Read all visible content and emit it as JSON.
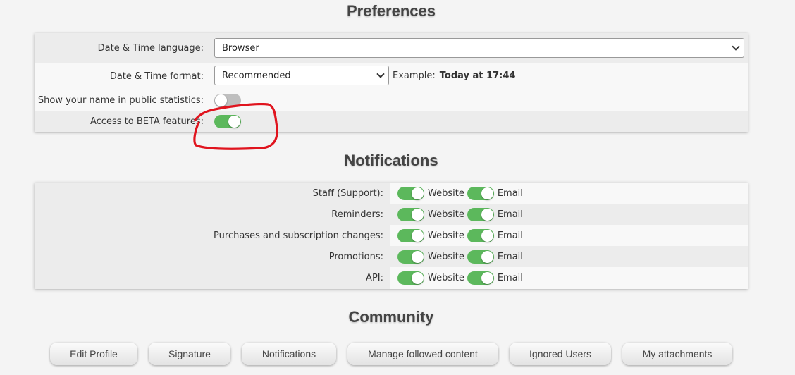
{
  "sections": {
    "preferences": "Preferences",
    "notifications": "Notifications",
    "community": "Community"
  },
  "preferences": {
    "date_time_language": {
      "label": "Date & Time language:",
      "value": "Browser"
    },
    "date_time_format": {
      "label": "Date & Time format:",
      "value": "Recommended",
      "example_prefix": "Example:",
      "example_value": "Today at 17:44"
    },
    "show_name": {
      "label": "Show your name in public statistics:",
      "enabled": false
    },
    "beta": {
      "label": "Access to BETA features:",
      "enabled": true
    }
  },
  "notifications": {
    "website_label": "Website",
    "email_label": "Email",
    "rows": [
      {
        "label": "Staff (Support):",
        "website": true,
        "email": true
      },
      {
        "label": "Reminders:",
        "website": true,
        "email": true
      },
      {
        "label": "Purchases and subscription changes:",
        "website": true,
        "email": true
      },
      {
        "label": "Promotions:",
        "website": true,
        "email": true
      },
      {
        "label": "API:",
        "website": true,
        "email": true
      }
    ]
  },
  "community": {
    "buttons": [
      "Edit Profile",
      "Signature",
      "Notifications",
      "Manage followed content",
      "Ignored Users",
      "My attachments"
    ]
  },
  "colors": {
    "toggle_on": "#5cb85c",
    "toggle_off": "#bfbfbf",
    "annotation": "#e0141e"
  }
}
